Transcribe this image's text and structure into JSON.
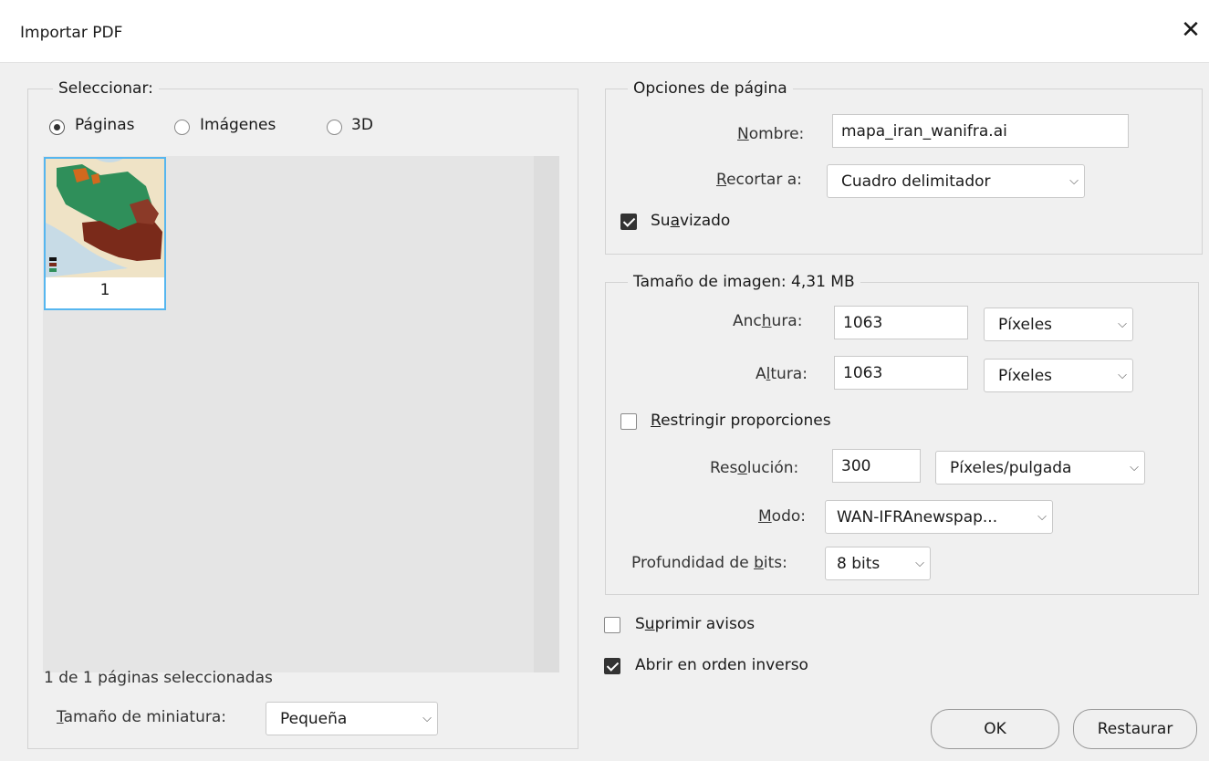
{
  "window": {
    "title": "Importar PDF",
    "close_glyph": "✕"
  },
  "select_group": {
    "legend": "Seleccionar:",
    "options": [
      {
        "label": "Páginas",
        "selected": true
      },
      {
        "label": "Imágenes",
        "selected": false
      },
      {
        "label": "3D",
        "selected": false
      }
    ],
    "thumbnail": {
      "page_number": "1",
      "selected": true
    },
    "status": "1 de 1 páginas seleccionadas",
    "thumb_size": {
      "label_pre": "",
      "label_u": "T",
      "label_post": "amaño de miniatura:",
      "value": "Pequeña"
    }
  },
  "page_options": {
    "legend": "Opciones de página",
    "name": {
      "label_u": "N",
      "label_post": "ombre:",
      "value": "mapa_iran_wanifra.ai"
    },
    "crop": {
      "label_u": "R",
      "label_post": "ecortar a:",
      "value": "Cuadro delimitador"
    },
    "antialias": {
      "label_pre": "Su",
      "label_u": "a",
      "label_post": "vizado",
      "checked": true
    }
  },
  "image_size": {
    "legend": "Tamaño de imagen: 4,31 MB",
    "width": {
      "label_pre": "Anc",
      "label_u": "h",
      "label_post": "ura:",
      "value": "1063",
      "unit": "Píxeles"
    },
    "height": {
      "label_pre": "A",
      "label_u": "l",
      "label_post": "tura:",
      "value": "1063",
      "unit": "Píxeles"
    },
    "constrain": {
      "label_u": "R",
      "label_post": "estringir proporciones",
      "checked": false
    },
    "resolution": {
      "label_pre": "Res",
      "label_u": "o",
      "label_post": "lución:",
      "value": "300",
      "unit": "Píxeles/pulgada"
    },
    "mode": {
      "label_u": "M",
      "label_post": "odo:",
      "value": "WAN-IFRAnewspap..."
    },
    "bit_depth": {
      "label_pre": "Profundidad de ",
      "label_u": "b",
      "label_post": "its:",
      "value": "8 bits"
    }
  },
  "suppress_warnings": {
    "label_pre": "S",
    "label_u": "u",
    "label_post": "primir avisos",
    "checked": false
  },
  "reverse_order": {
    "label": "Abrir en orden inverso",
    "checked": true
  },
  "buttons": {
    "ok": "OK",
    "reset": "Restaurar"
  },
  "map_colors": {
    "green": "#2f8f5a",
    "brown": "#7a2a1a",
    "orange": "#d2691e",
    "sea": "#c7dbe6",
    "land": "#efe3c6"
  }
}
